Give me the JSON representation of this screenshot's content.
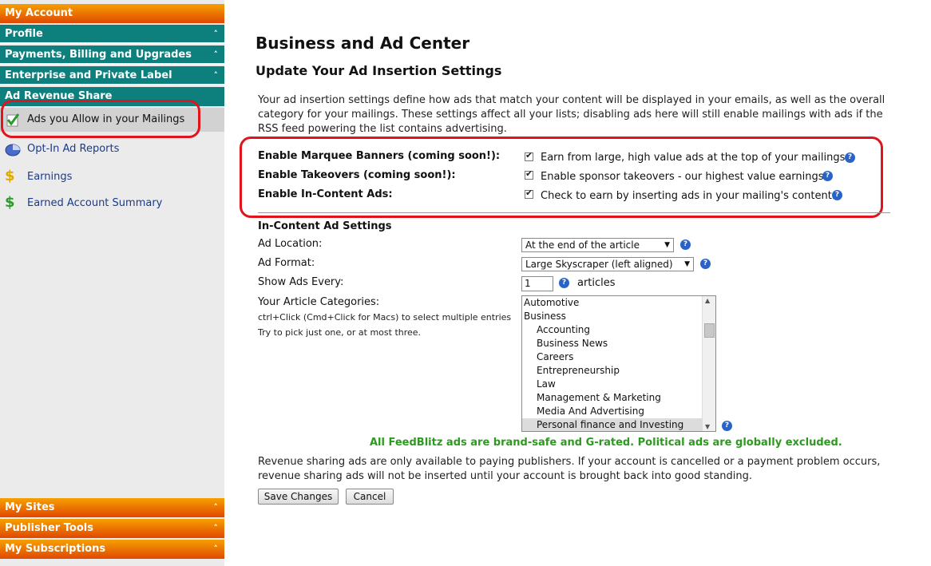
{
  "sidebar": {
    "my_account": "My Account",
    "profile": "Profile",
    "payments": "Payments, Billing and Upgrades",
    "enterprise": "Enterprise and Private Label",
    "ad_revenue": "Ad Revenue Share",
    "items": [
      {
        "label": "Ads you Allow in your Mailings",
        "icon": "checklist-icon"
      },
      {
        "label": "Opt-In Ad Reports",
        "icon": "pie-chart-icon"
      },
      {
        "label": "Earnings",
        "icon": "dollar-icon"
      },
      {
        "label": "Earned Account Summary",
        "icon": "dollar-green-icon"
      }
    ],
    "my_sites": "My Sites",
    "publisher_tools": "Publisher Tools",
    "my_subscriptions": "My Subscriptions",
    "chevron": "˄"
  },
  "main": {
    "title": "Business and Ad Center",
    "subtitle": "Update Your Ad Insertion Settings",
    "intro": "Your ad insertion settings define how ads that match your content will be displayed in your emails, as well as the overall category for your mailings. These settings affect all your lists; disabling ads here will still enable mailings with ads if the RSS feed powering the list contains advertising.",
    "enable": [
      {
        "label": "Enable Marquee Banners (coming soon!):",
        "desc": "Earn from large, high value ads at the top of your mailings.",
        "checked": true
      },
      {
        "label": "Enable Takeovers (coming soon!):",
        "desc": "Enable sponsor takeovers - our highest value earnings.",
        "checked": true
      },
      {
        "label": "Enable In-Content Ads:",
        "desc": "Check to earn by inserting ads in your mailing's content.",
        "checked": true
      }
    ],
    "help": "?",
    "in_content_title": "In-Content Ad Settings",
    "ad_location_label": "Ad Location:",
    "ad_location_value": "At the end of the article",
    "ad_format_label": "Ad Format:",
    "ad_format_value": "Large Skyscraper (left aligned)",
    "show_every_label": "Show Ads Every:",
    "show_every_value": "1",
    "articles": "articles",
    "categories_label": "Your Article Categories:",
    "categories_hint1": "ctrl+Click (Cmd+Click for Macs) to select multiple entries",
    "categories_hint2": "Try to pick just one, or at most three.",
    "categories": [
      {
        "label": "Automotive",
        "child": false
      },
      {
        "label": "Business",
        "child": false
      },
      {
        "label": "Accounting",
        "child": true
      },
      {
        "label": "Business News",
        "child": true
      },
      {
        "label": "Careers",
        "child": true
      },
      {
        "label": "Entrepreneurship",
        "child": true
      },
      {
        "label": "Law",
        "child": true
      },
      {
        "label": "Management & Marketing",
        "child": true
      },
      {
        "label": "Media And Advertising",
        "child": true
      },
      {
        "label": "Personal finance and Investing",
        "child": true,
        "selected": true
      }
    ],
    "brand_safe": "All FeedBlitz ads are brand-safe and G-rated. Political ads are globally excluded.",
    "revenue_note": "Revenue sharing ads are only available to paying publishers. If your account is cancelled or a payment problem occurs, revenue sharing ads will not be inserted until your account is brought back into good standing.",
    "save": "Save Changes",
    "cancel": "Cancel"
  },
  "colors": {
    "orange": "#e85a00",
    "teal": "#0d7f7d",
    "highlight": "#e0141c",
    "link": "#1a3a8a",
    "green": "#2b9a1e"
  }
}
